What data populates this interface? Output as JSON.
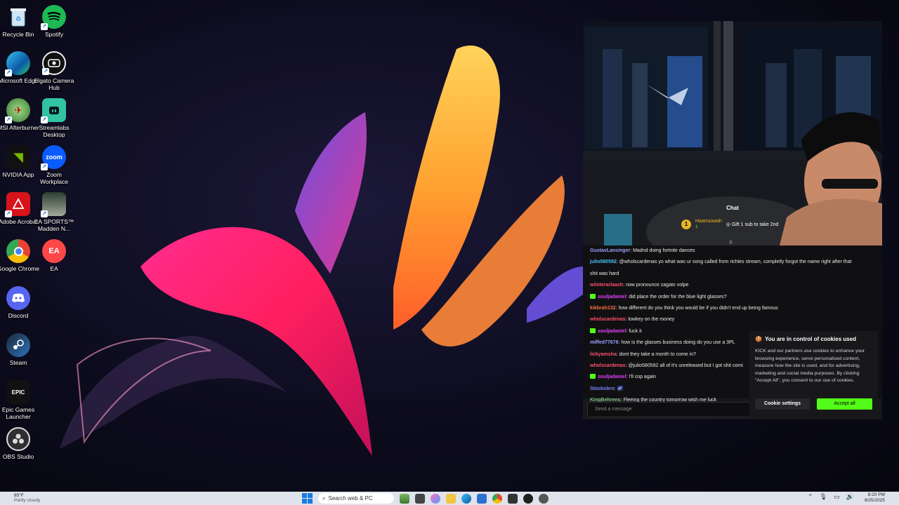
{
  "desktop": {
    "icons": [
      {
        "label": "Recycle Bin",
        "icon": "recycle-bin-icon"
      },
      {
        "label": "Spotify",
        "icon": "spotify-icon"
      },
      {
        "label": "Microsoft Edge",
        "icon": "edge-icon"
      },
      {
        "label": "Elgato Camera Hub",
        "icon": "elgato-icon"
      },
      {
        "label": "MSI Afterburner",
        "icon": "msi-icon"
      },
      {
        "label": "Streamlabs Desktop",
        "icon": "streamlabs-icon"
      },
      {
        "label": "NVIDIA App",
        "icon": "nvidia-icon"
      },
      {
        "label": "Zoom Workplace",
        "icon": "zoom-icon"
      },
      {
        "label": "Adobe Acrobat",
        "icon": "acrobat-icon"
      },
      {
        "label": "EA SPORTS™ Madden N...",
        "icon": "madden-icon"
      },
      {
        "label": "Google Chrome",
        "icon": "chrome-icon"
      },
      {
        "label": "EA",
        "icon": "ea-icon"
      },
      {
        "label": "Discord",
        "icon": "discord-icon"
      },
      {
        "label": "Steam",
        "icon": "steam-icon"
      },
      {
        "label": "Epic Games Launcher",
        "icon": "epic-icon"
      },
      {
        "label": "OBS Studio",
        "icon": "obs-icon"
      }
    ],
    "icon_glyphs": {
      "zoom": "zoom",
      "ea": "EA",
      "epic": "EPIC",
      "nvidia": "◥"
    }
  },
  "stream": {
    "chat_title": "Chat",
    "pinned": {
      "user": "Haamzaaah",
      "count": "1",
      "coin": "1",
      "gift": "Gift 1 sub to take 2nd"
    },
    "messages": [
      {
        "user": "GustavLansinger",
        "color": "#9aa0ff",
        "badge": false,
        "text": "Madnd doing fortnite dances"
      },
      {
        "user": "julio580592",
        "color": "#4fc3f7",
        "badge": false,
        "text": "@wholscardenas yo what was ur song called from richies stream, completly forgot the name right after that"
      },
      {
        "user": "",
        "color": "#ffffff",
        "badge": false,
        "text": "shit was hard"
      },
      {
        "user": "wiinterarlaash",
        "color": "#ff4f6d",
        "badge": false,
        "text": "now pronounce zagato volpe"
      },
      {
        "user": "souljadaniel",
        "color": "#e040fb",
        "badge": true,
        "text": "did place the order for the blue light glasses?"
      },
      {
        "user": "kikbrah132",
        "color": "#ff7043",
        "badge": false,
        "text": "how different do you think you would be if you didn't end up being famous"
      },
      {
        "user": "wholscardenas",
        "color": "#ff4f6d",
        "badge": false,
        "text": "lowkey on the money"
      },
      {
        "user": "souljadaniel",
        "color": "#e040fb",
        "badge": true,
        "text": "fuck it"
      },
      {
        "user": "miffed77676",
        "color": "#9aa0ff",
        "badge": false,
        "text": "how is the glasses business doing do you use a 3PL"
      },
      {
        "user": "lickyamsha",
        "color": "#ff4f6d",
        "badge": false,
        "text": "dont they take a month to come in?"
      },
      {
        "user": "wholscardenas",
        "color": "#ff4f6d",
        "badge": false,
        "text": "@julio580592 all of it's unreleased but I got shit comi"
      },
      {
        "user": "souljadaniel",
        "color": "#e040fb",
        "badge": true,
        "text": "I'll cop again"
      },
      {
        "user": "Stockobro",
        "color": "#7c83ff",
        "badge": false,
        "text": "🌌"
      },
      {
        "user": "KingBehrens",
        "color": "#81c784",
        "badge": false,
        "text": "Fleeing the country tomorrow wish me luck"
      }
    ],
    "send_placeholder": "Send a message"
  },
  "cookies": {
    "title": "You are in control of cookies used",
    "body": "KICK and our partners use cookies to enhance your browsing experience, serve personalised content, measure how the site is used, and for advertising, marketing and social media purposes. By clicking \"Accept All\", you consent to our use of cookies.",
    "settings_label": "Cookie settings",
    "accept_label": "Accept all"
  },
  "taskbar": {
    "weather_temp": "85°F",
    "weather_desc": "Partly cloudy",
    "search_label": "Search web & PC",
    "time": "8:20 PM",
    "date": "8/25/2025"
  },
  "colors": {
    "kick_green": "#53fc18",
    "taskbar": "#dfe3ec"
  }
}
